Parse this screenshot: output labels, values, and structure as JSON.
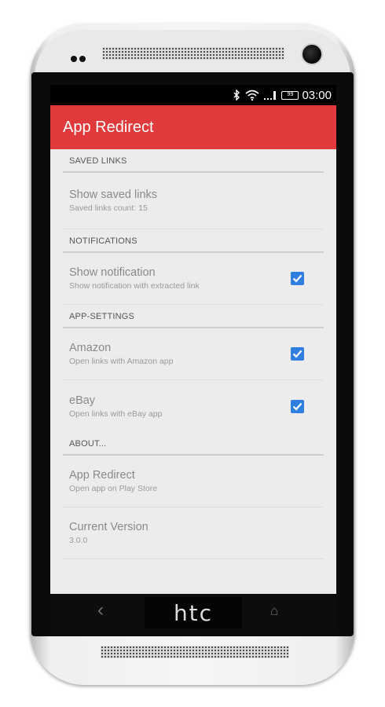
{
  "status_bar": {
    "time": "03:00",
    "battery": "99",
    "icons": [
      "bluetooth-icon",
      "wifi-icon",
      "signal-icon",
      "battery-icon"
    ]
  },
  "app_bar": {
    "title": "App Redirect",
    "color": "#e03a3c"
  },
  "sections": {
    "saved_links": {
      "header": "SAVED LINKS",
      "items": [
        {
          "title": "Show saved links",
          "summary": "Saved links count: 15"
        }
      ]
    },
    "notifications": {
      "header": "NOTIFICATIONS",
      "items": [
        {
          "title": "Show notification",
          "summary": "Show notification with extracted link",
          "checked": true
        }
      ]
    },
    "app_settings": {
      "header": "APP-SETTINGS",
      "items": [
        {
          "title": "Amazon",
          "summary": "Open links with Amazon app",
          "checked": true
        },
        {
          "title": "eBay",
          "summary": "Open links with eBay app",
          "checked": true
        }
      ]
    },
    "about": {
      "header": "ABOUT...",
      "items": [
        {
          "title": "App Redirect",
          "summary": "Open app on Play Store"
        },
        {
          "title": "Current Version",
          "summary": "3.0.0"
        }
      ]
    }
  },
  "device": {
    "brand": "htc",
    "nav_back": "‹",
    "nav_home": "⌂"
  },
  "colors": {
    "accent": "#e03a3c",
    "checkbox": "#2f7fe0"
  }
}
